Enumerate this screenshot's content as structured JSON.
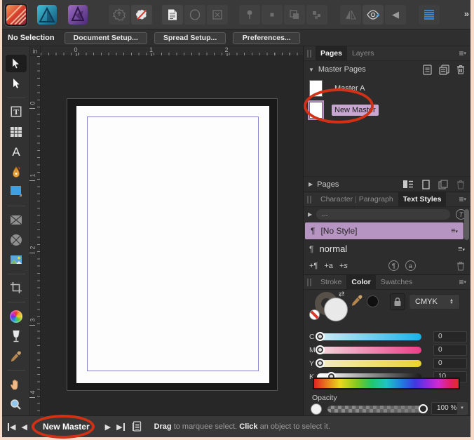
{
  "colors": {
    "annotation_red": "#d23115",
    "selection_purple": "#b795c2",
    "cyan": "#18b4ea",
    "magenta": "#eb3f88",
    "yellow": "#ecd42e"
  },
  "icons": {
    "menu": "≡",
    "caret_down": "▾",
    "disclosure_open": "▼",
    "disclosure_closed": "▶",
    "prev": "◀",
    "next": "▶",
    "swap": "⇄",
    "paragraph": "¶",
    "updown_up": "▲",
    "updown_down": "▼",
    "overflow": "»"
  },
  "context_toolbar": {
    "status": "No Selection",
    "buttons": [
      "Document Setup...",
      "Spread Setup...",
      "Preferences..."
    ]
  },
  "rulers": {
    "unit": "in",
    "horizontal": [
      "0",
      "1",
      "2"
    ],
    "vertical": [
      "0",
      "1",
      "2",
      "3",
      "4"
    ]
  },
  "pages_panel": {
    "tab_pages": "Pages",
    "tab_layers": "Layers",
    "master_section": "Master Pages",
    "masters": [
      {
        "name": "Master A",
        "selected": false
      },
      {
        "name": "New Master",
        "selected": true
      }
    ],
    "pages_section": "Pages"
  },
  "text_styles_panel": {
    "tab_character": "Character",
    "tab_paragraph": "Paragraph",
    "tab_text_styles": "Text Styles",
    "separator": "|",
    "filter_value": "...",
    "detect_glyph": "T",
    "styles": [
      {
        "name": "[No Style]",
        "selected": true
      },
      {
        "name": "normal",
        "selected": false
      }
    ],
    "actions": {
      "add_paragraph_style": "+¶",
      "add_character_style": "+a",
      "add_group_style": "+s",
      "apply_paragraph": "¶",
      "apply_character": "a"
    }
  },
  "color_panel": {
    "tab_stroke": "Stroke",
    "tab_color": "Color",
    "tab_swatches": "Swatches",
    "mode": "CMYK",
    "sliders": [
      {
        "label": "C",
        "value": "0"
      },
      {
        "label": "M",
        "value": "0"
      },
      {
        "label": "Y",
        "value": "0"
      },
      {
        "label": "K",
        "value": "10"
      }
    ],
    "opacity_label": "Opacity",
    "opacity_value": "100 %"
  },
  "status_bar": {
    "page_label": "New Master",
    "hint": [
      {
        "text": "Drag"
      },
      {
        "text": " to marquee select. "
      },
      {
        "text": "Click"
      },
      {
        "text": " an object to select it."
      }
    ]
  }
}
